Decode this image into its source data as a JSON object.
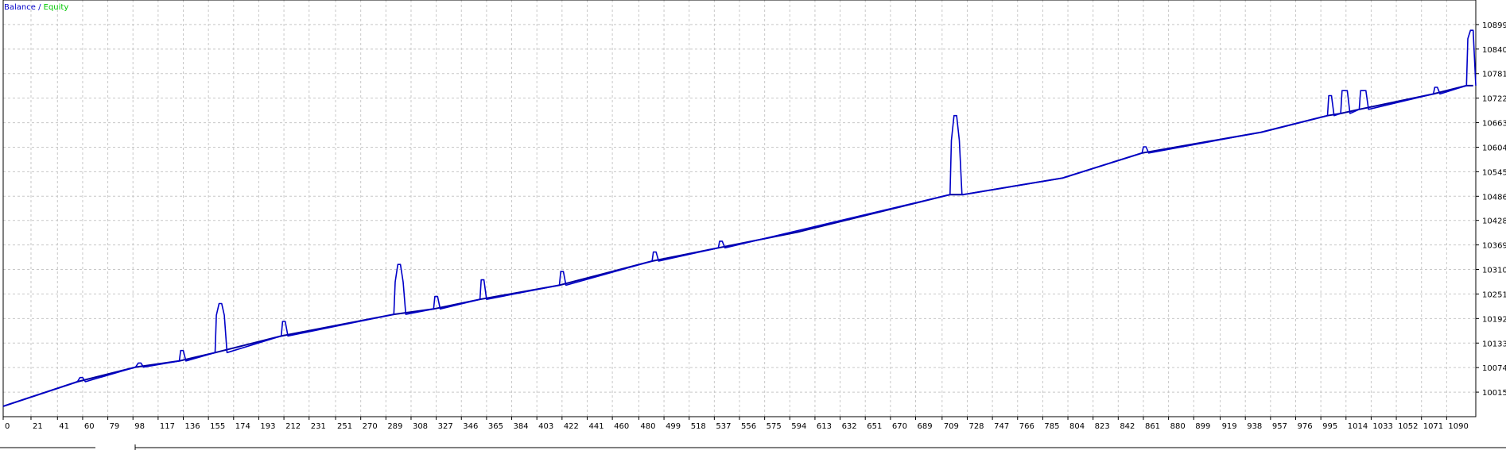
{
  "chart_data": {
    "type": "line",
    "title": "",
    "xlabel": "",
    "ylabel": "",
    "legend": {
      "position": "top-left",
      "balance_label": "Balance",
      "separator": "/",
      "equity_label": "Equity"
    },
    "grid": true,
    "xlim": [
      0,
      1112
    ],
    "ylim": [
      9956,
      10958
    ],
    "x_ticks": [
      0,
      21,
      41,
      60,
      79,
      98,
      117,
      136,
      155,
      174,
      193,
      212,
      231,
      251,
      270,
      289,
      308,
      327,
      346,
      365,
      384,
      403,
      422,
      441,
      460,
      480,
      499,
      518,
      537,
      556,
      575,
      594,
      613,
      632,
      651,
      670,
      689,
      709,
      728,
      747,
      766,
      785,
      804,
      823,
      842,
      861,
      880,
      899,
      919,
      938,
      957,
      976,
      995,
      1014,
      1033,
      1052,
      1071,
      1090
    ],
    "y_ticks": [
      10015,
      10074,
      10133,
      10192,
      10251,
      10310,
      10369,
      10428,
      10486,
      10545,
      10604,
      10663,
      10722,
      10781,
      10840,
      10899
    ],
    "colors": {
      "balance": "#0000a0",
      "equity": "#0000c8",
      "legend_balance": "#0000c8",
      "legend_equity": "#00c800",
      "grid": "#c8c8c8",
      "axis": "#000000"
    },
    "series": [
      {
        "name": "Balance",
        "x": [
          0,
          56,
          100,
          133,
          160,
          210,
          295,
          325,
          360,
          420,
          490,
          540,
          600,
          715,
          725,
          800,
          860,
          950,
          1000,
          1010,
          1024,
          1080,
          1105,
          1110
        ],
        "values": [
          9981,
          10040,
          10075,
          10090,
          10110,
          10150,
          10202,
          10215,
          10238,
          10272,
          10330,
          10362,
          10400,
          10490,
          10490,
          10530,
          10590,
          10640,
          10680,
          10685,
          10695,
          10732,
          10752,
          10752
        ]
      },
      {
        "name": "Equity",
        "x": [
          0,
          56,
          58,
          60,
          62,
          100,
          102,
          104,
          106,
          133,
          134,
          136,
          138,
          160,
          161,
          163,
          165,
          167,
          169,
          210,
          211,
          213,
          215,
          295,
          296,
          298,
          300,
          302,
          304,
          325,
          326,
          328,
          330,
          360,
          361,
          363,
          365,
          420,
          421,
          423,
          425,
          490,
          491,
          493,
          495,
          540,
          541,
          543,
          545,
          715,
          716,
          718,
          720,
          722,
          724,
          725,
          800,
          860,
          861,
          863,
          865,
          950,
          1000,
          1001,
          1003,
          1005,
          1010,
          1011,
          1013,
          1015,
          1017,
          1024,
          1025,
          1027,
          1029,
          1031,
          1080,
          1081,
          1083,
          1085,
          1105,
          1106,
          1108,
          1110,
          1112
        ],
        "values": [
          9981,
          10040,
          10050,
          10050,
          10040,
          10075,
          10085,
          10085,
          10075,
          10090,
          10115,
          10115,
          10090,
          10110,
          10200,
          10228,
          10228,
          10200,
          10110,
          10150,
          10185,
          10185,
          10150,
          10202,
          10280,
          10322,
          10322,
          10280,
          10202,
          10215,
          10245,
          10245,
          10215,
          10238,
          10285,
          10285,
          10238,
          10272,
          10305,
          10305,
          10272,
          10330,
          10352,
          10352,
          10330,
          10362,
          10378,
          10378,
          10362,
          10490,
          10620,
          10680,
          10680,
          10620,
          10490,
          10490,
          10530,
          10590,
          10605,
          10605,
          10590,
          10640,
          10680,
          10728,
          10728,
          10680,
          10685,
          10740,
          10740,
          10740,
          10685,
          10695,
          10740,
          10740,
          10740,
          10695,
          10732,
          10748,
          10748,
          10732,
          10752,
          10865,
          10885,
          10885,
          10752
        ]
      }
    ]
  }
}
